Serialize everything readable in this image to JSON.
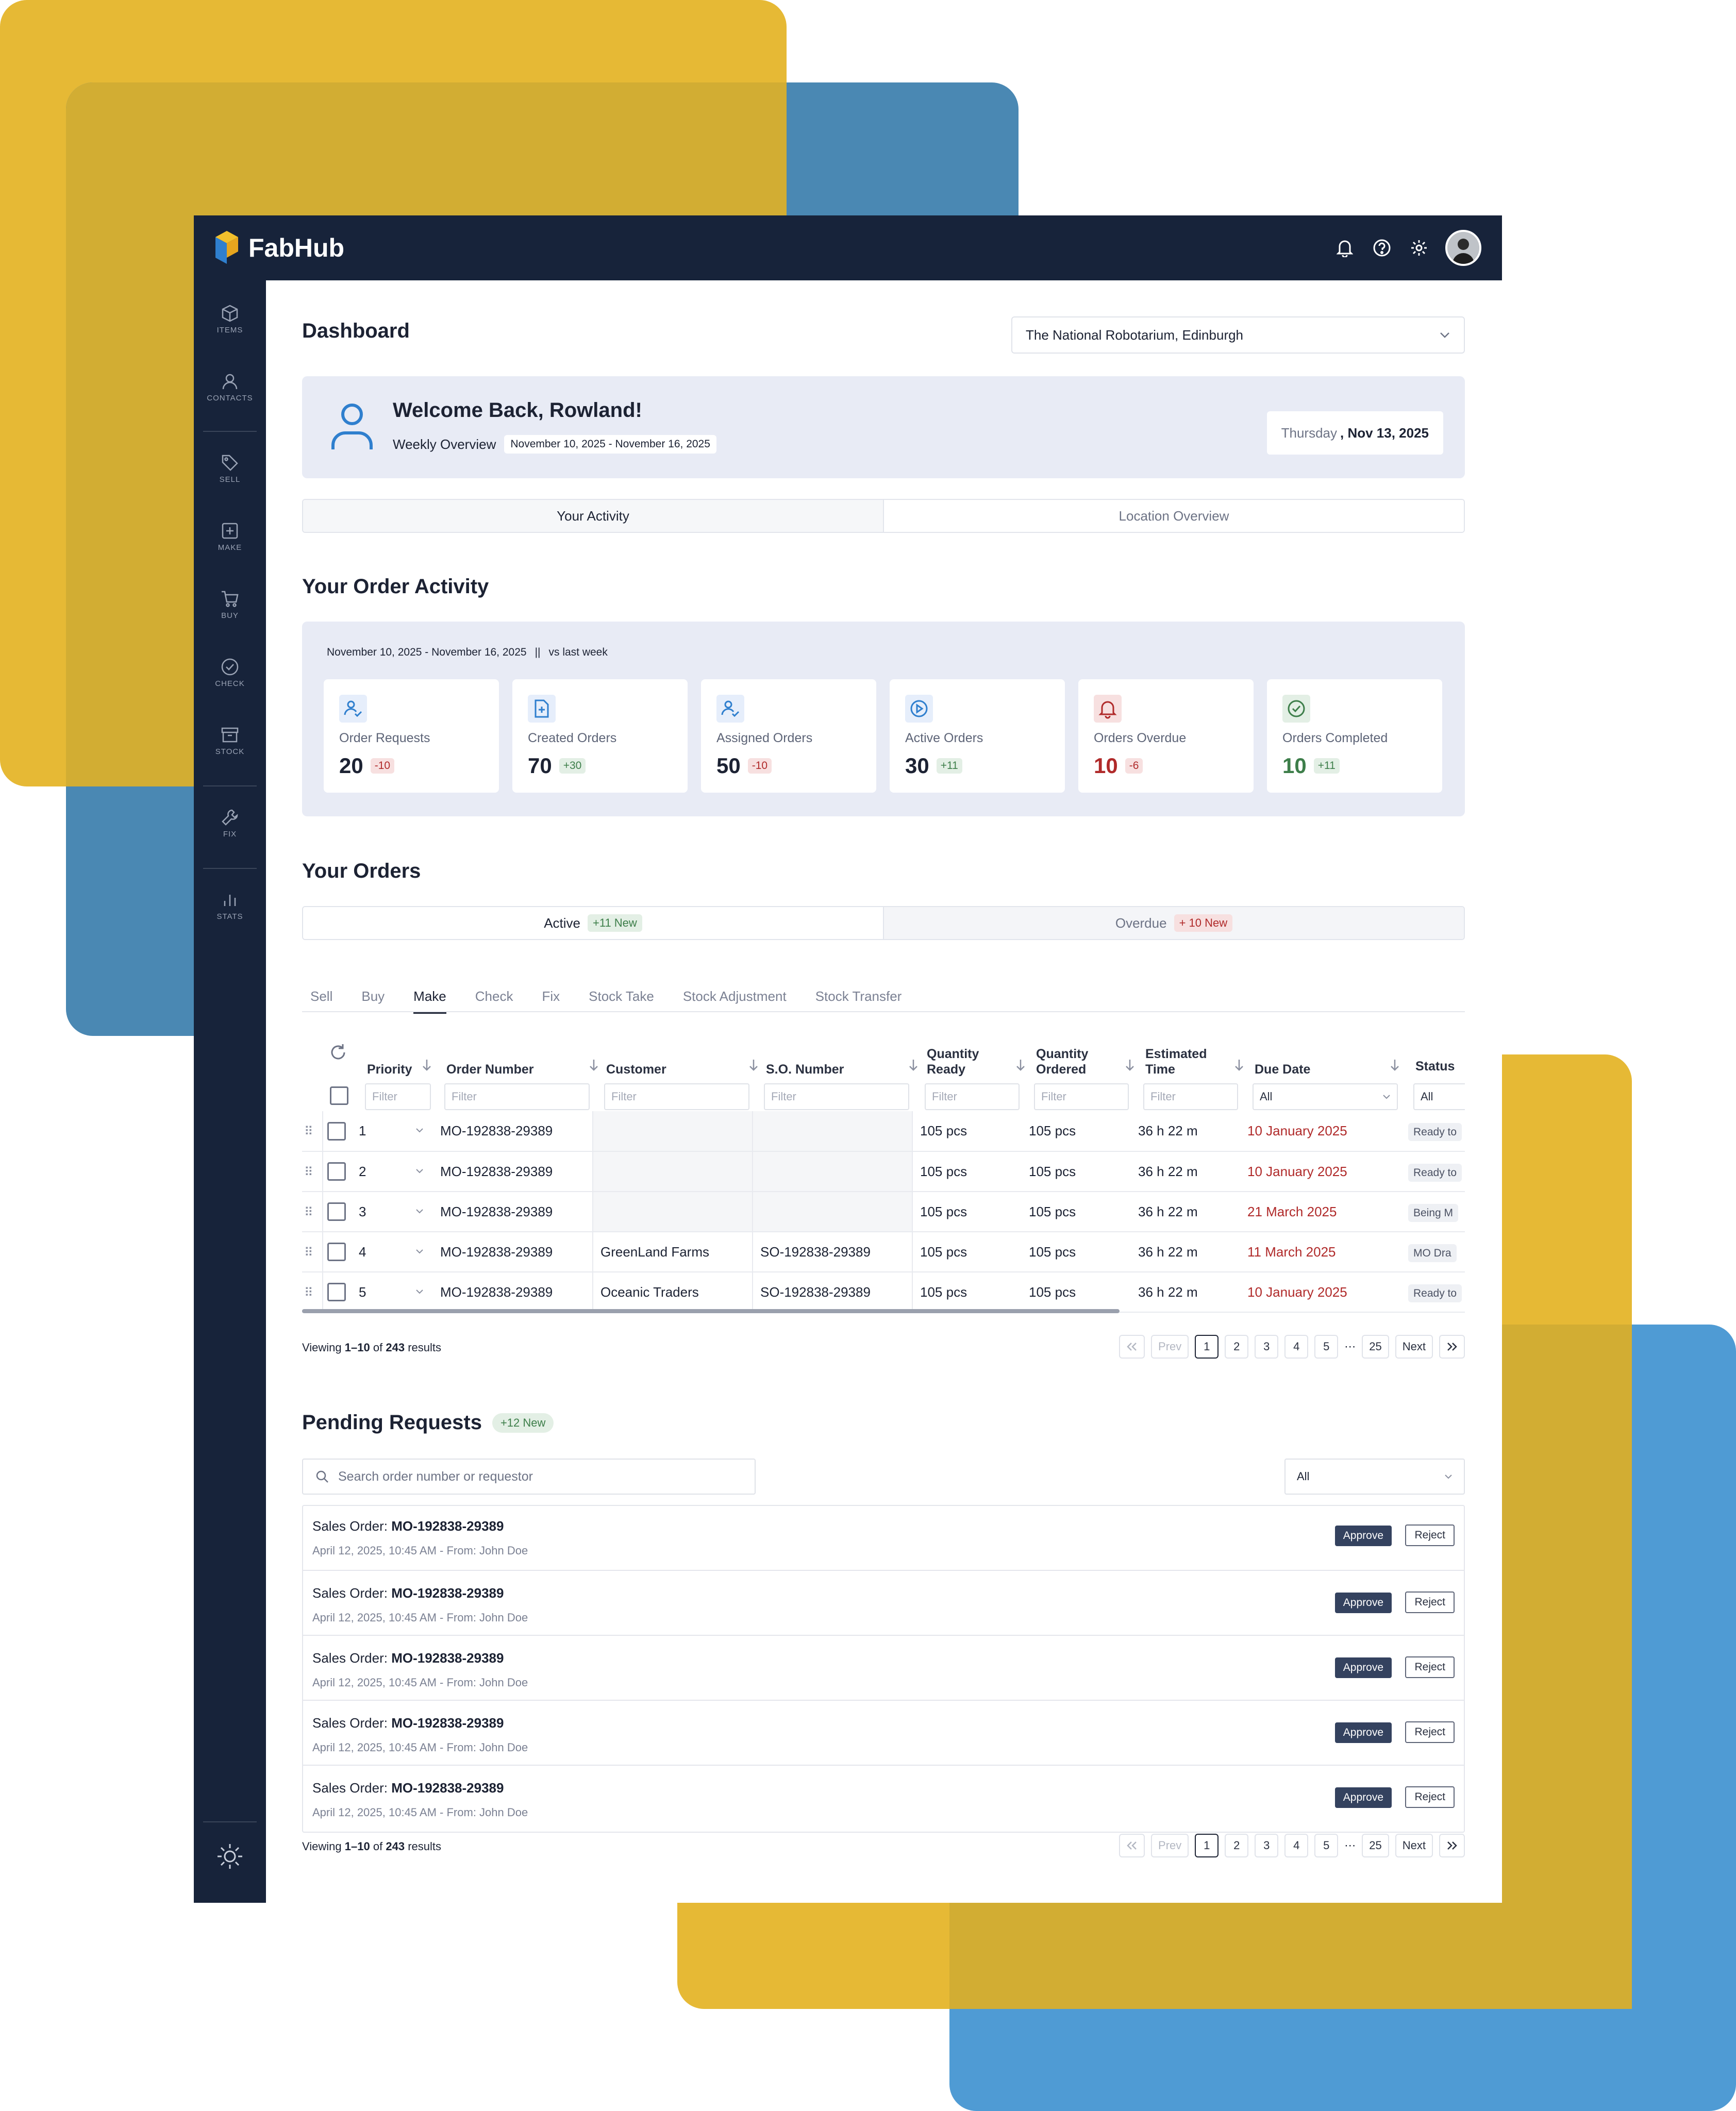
{
  "app": {
    "name": "FabHub"
  },
  "sidebar": {
    "items": [
      {
        "label": "ITEMS",
        "icon": "box-icon"
      },
      {
        "label": "CONTACTS",
        "icon": "person-icon"
      },
      {
        "label": "SELL",
        "icon": "tag-icon"
      },
      {
        "label": "MAKE",
        "icon": "plus-square-icon"
      },
      {
        "label": "BUY",
        "icon": "cart-icon"
      },
      {
        "label": "CHECK",
        "icon": "check-circle-icon"
      },
      {
        "label": "STOCK",
        "icon": "archive-icon"
      },
      {
        "label": "FIX",
        "icon": "wrench-icon"
      },
      {
        "label": "STATS",
        "icon": "bar-chart-icon"
      }
    ]
  },
  "header": {
    "title": "Dashboard",
    "location": "The National Robotarium, Edinburgh"
  },
  "welcome": {
    "title": "Welcome Back, Rowland!",
    "overview_label": "Weekly Overview",
    "range": "November 10, 2025 - November 16, 2025",
    "day": "Thursday",
    "date": ", Nov 13, 2025"
  },
  "view_tabs": [
    "Your Activity",
    "Location Overview"
  ],
  "activity": {
    "title": "Your Order Activity",
    "range": "November 10, 2025 - November 16, 2025",
    "separator": "||",
    "compare": "vs last week",
    "cards": [
      {
        "label": "Order Requests",
        "value": "20",
        "delta": "-10",
        "tone": "neg",
        "icon": "person-check-icon"
      },
      {
        "label": "Created Orders",
        "value": "70",
        "delta": "+30",
        "tone": "pos",
        "icon": "document-plus-icon"
      },
      {
        "label": "Assigned Orders",
        "value": "50",
        "delta": "-10",
        "tone": "neg",
        "icon": "person-check-icon"
      },
      {
        "label": "Active Orders",
        "value": "30",
        "delta": "+11",
        "tone": "pos",
        "icon": "play-circle-icon"
      },
      {
        "label": "Orders Overdue",
        "value": "10",
        "delta": "-6",
        "tone": "neg",
        "icon": "bell-icon"
      },
      {
        "label": "Orders Completed",
        "value": "10",
        "delta": "+11",
        "tone": "pos",
        "icon": "check-circle-icon"
      }
    ]
  },
  "orders": {
    "title": "Your Orders",
    "tabs": [
      {
        "label": "Active",
        "badge": "+11 New"
      },
      {
        "label": "Overdue",
        "badge": "+ 10 New"
      }
    ],
    "subtabs": [
      "Sell",
      "Buy",
      "Make",
      "Check",
      "Fix",
      "Stock Take",
      "Stock Adjustment",
      "Stock Transfer"
    ],
    "active_subtab": "Make",
    "columns": [
      "Priority",
      "Order Number",
      "Customer",
      "S.O. Number",
      "Quantity Ready",
      "Quantity Ordered",
      "Estimated Time",
      "Due Date",
      "Status"
    ],
    "filter_placeholder": "Filter",
    "select_all": "All",
    "rows": [
      {
        "priority": "1",
        "order": "MO-192838-29389",
        "customer": "",
        "so": "",
        "ready": "105 pcs",
        "ordered": "105 pcs",
        "time": "36 h 22 m",
        "due": "10 January 2025",
        "status": "Ready to"
      },
      {
        "priority": "2",
        "order": "MO-192838-29389",
        "customer": "",
        "so": "",
        "ready": "105 pcs",
        "ordered": "105 pcs",
        "time": "36 h 22 m",
        "due": "10 January 2025",
        "status": "Ready to"
      },
      {
        "priority": "3",
        "order": "MO-192838-29389",
        "customer": "",
        "so": "",
        "ready": "105 pcs",
        "ordered": "105 pcs",
        "time": "36 h 22 m",
        "due": "21 March 2025",
        "status": "Being M"
      },
      {
        "priority": "4",
        "order": "MO-192838-29389",
        "customer": "GreenLand Farms",
        "so": "SO-192838-29389",
        "ready": "105 pcs",
        "ordered": "105 pcs",
        "time": "36 h 22 m",
        "due": "11 March 2025",
        "status": "MO Dra"
      },
      {
        "priority": "5",
        "order": "MO-192838-29389",
        "customer": "Oceanic Traders",
        "so": "SO-192838-29389",
        "ready": "105 pcs",
        "ordered": "105 pcs",
        "time": "36 h 22 m",
        "due": "10 January 2025",
        "status": "Ready to"
      }
    ],
    "footer": {
      "viewing": "Viewing",
      "range": "1–10",
      "of": "of",
      "total": "243",
      "results": "results"
    }
  },
  "pager": {
    "prev": "Prev",
    "next": "Next",
    "pages": [
      "1",
      "2",
      "3",
      "4",
      "5"
    ],
    "ellipsis": "⋯",
    "last": "25",
    "current": "1"
  },
  "pending": {
    "title": "Pending Requests",
    "badge": "+12 New",
    "search_placeholder": "Search order number or requestor",
    "filter_value": "All",
    "items": [
      {
        "prefix": "Sales Order:",
        "order": "MO-192838-29389",
        "meta": "April 12, 2025, 10:45 AM - From: John Doe"
      },
      {
        "prefix": "Sales Order:",
        "order": "MO-192838-29389",
        "meta": "April 12, 2025, 10:45 AM - From: John Doe"
      },
      {
        "prefix": "Sales Order:",
        "order": "MO-192838-29389",
        "meta": "April 12, 2025, 10:45 AM - From: John Doe"
      },
      {
        "prefix": "Sales Order:",
        "order": "MO-192838-29389",
        "meta": "April 12, 2025, 10:45 AM - From: John Doe"
      },
      {
        "prefix": "Sales Order:",
        "order": "MO-192838-29389",
        "meta": "April 12, 2025, 10:45 AM - From: John Doe"
      }
    ],
    "approve_label": "Approve",
    "reject_label": "Reject",
    "footer": {
      "viewing": "Viewing",
      "range": "1–10",
      "of": "of",
      "total": "243",
      "results": "results"
    }
  },
  "colors": {
    "navy": "#17233a",
    "yellow": "#e6b935",
    "blue": "#4a88b3",
    "negative": "#b02a2a",
    "positive": "#3d7e4a"
  }
}
